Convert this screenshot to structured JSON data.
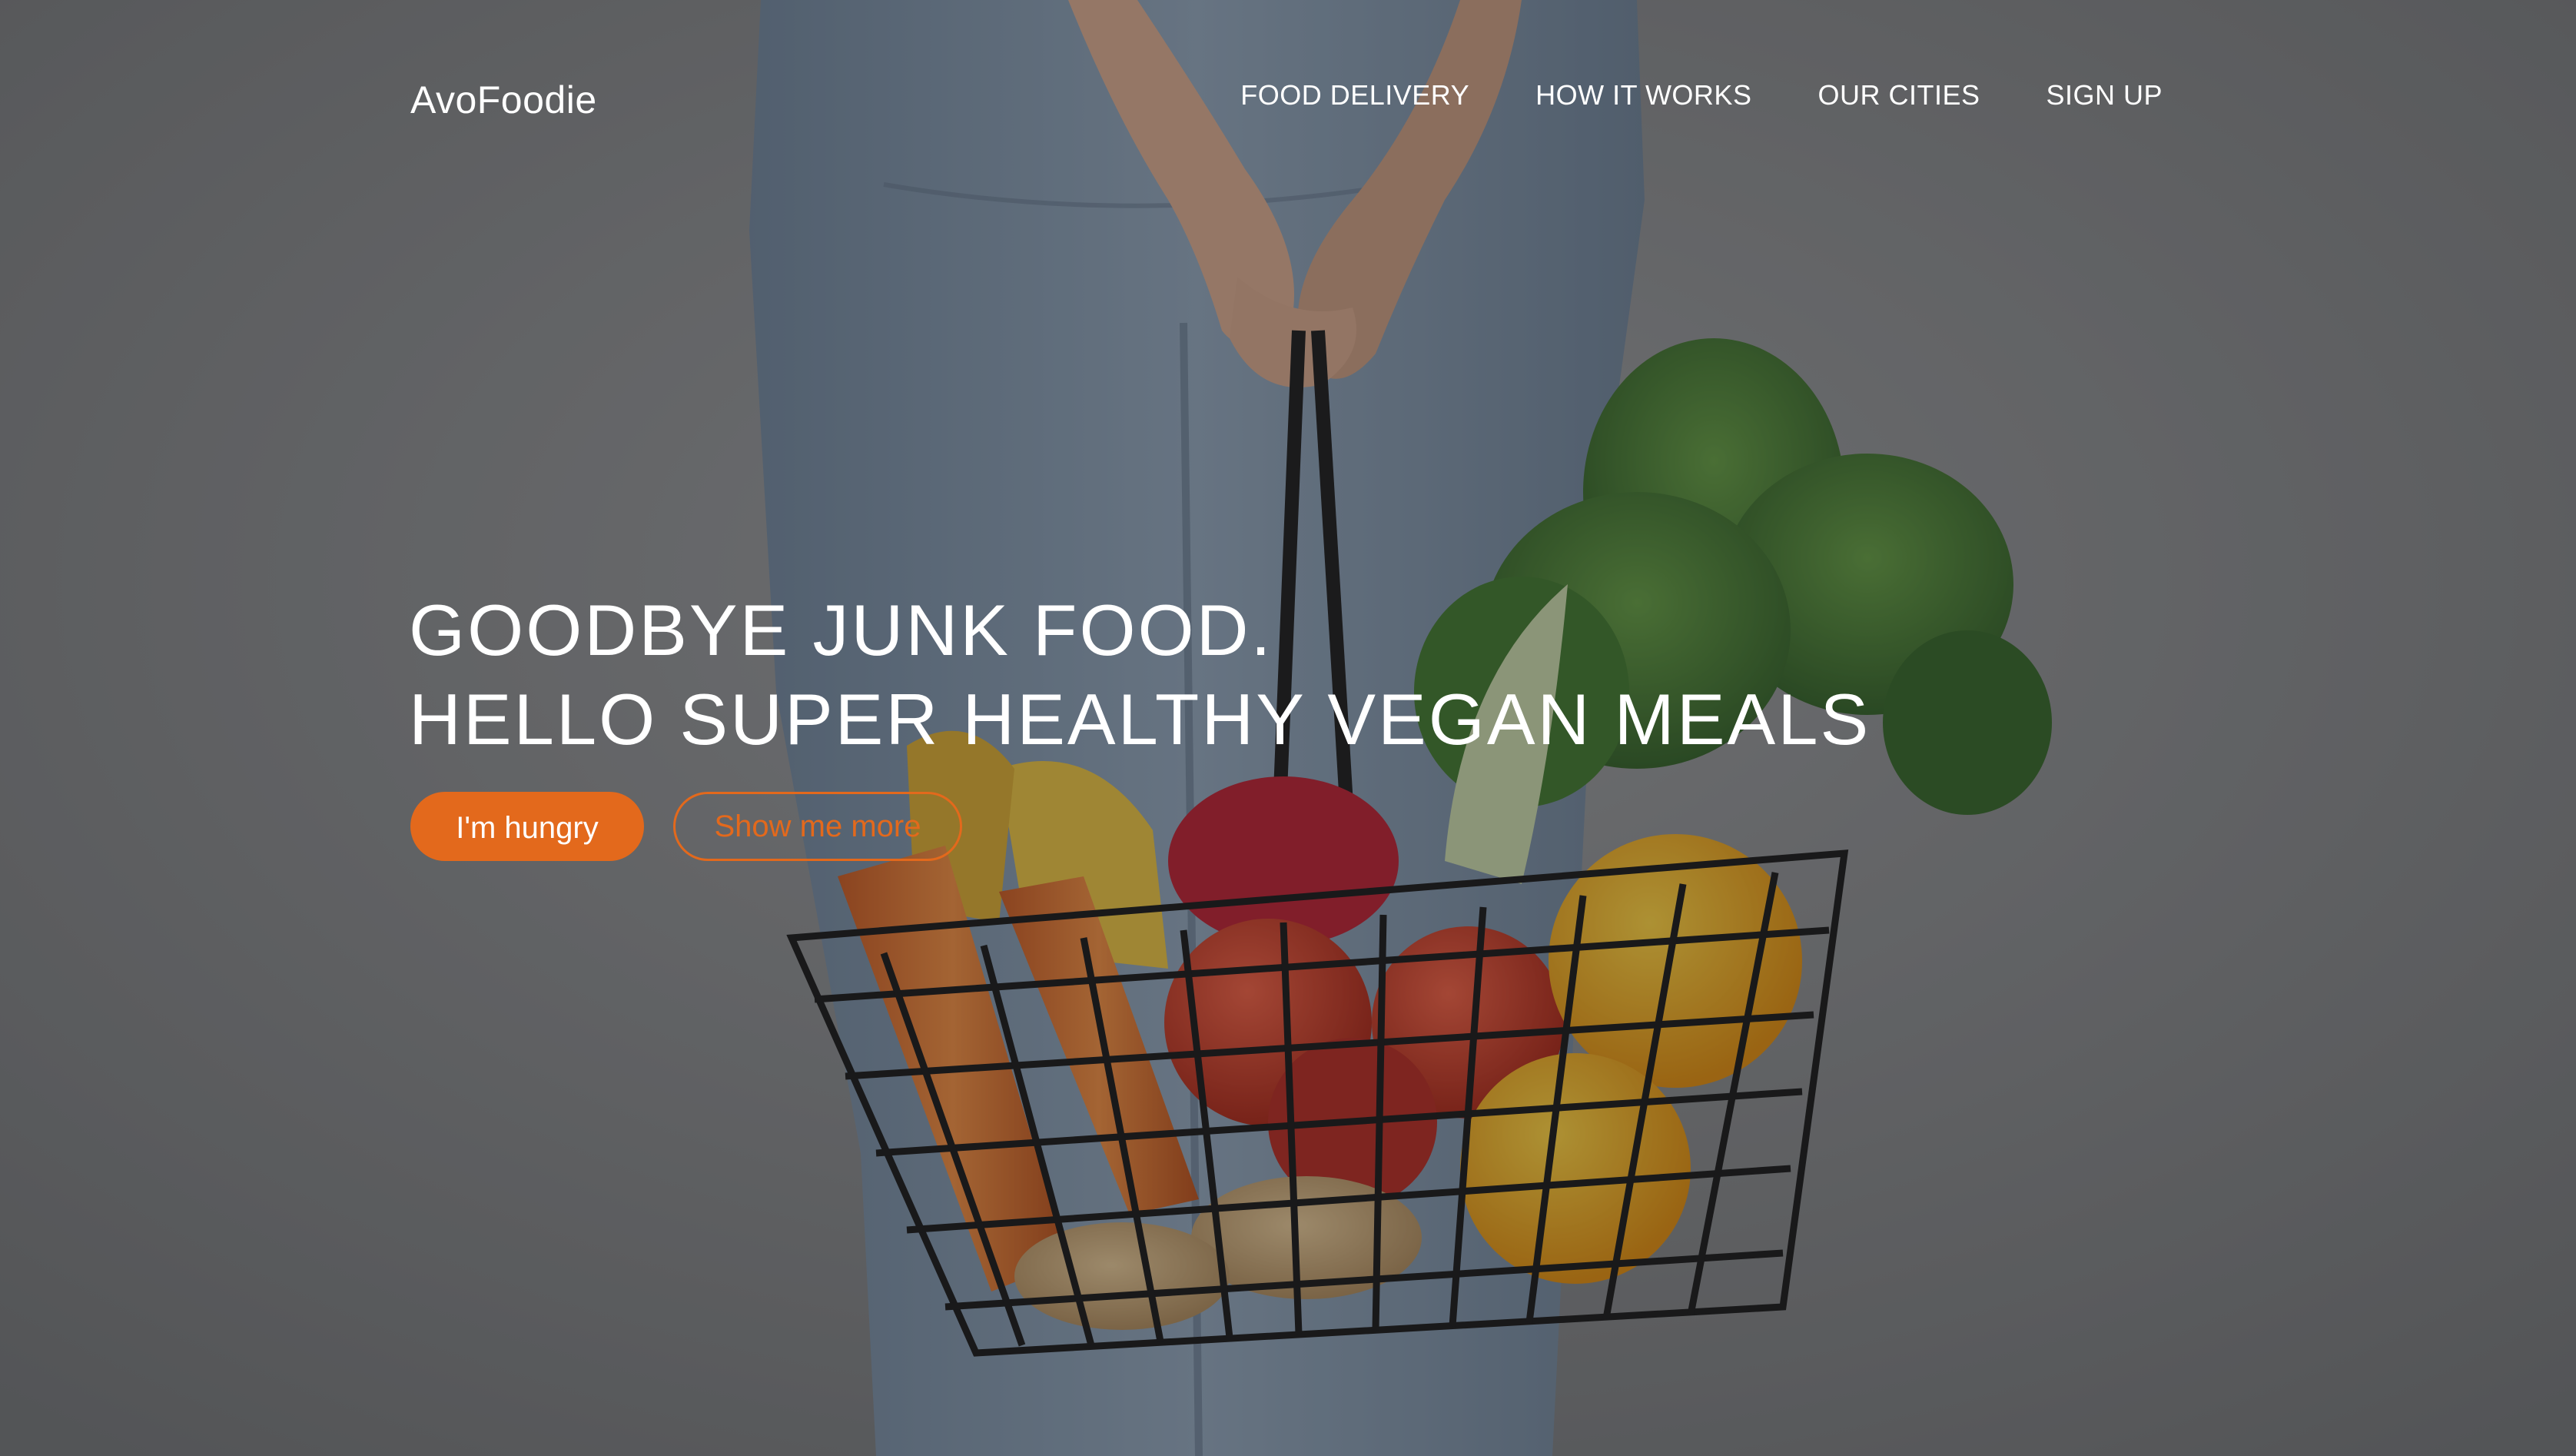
{
  "nav": {
    "logo": "AvoFoodie",
    "items": [
      {
        "label": "FOOD DELIVERY"
      },
      {
        "label": "HOW IT WORKS"
      },
      {
        "label": "OUR CITIES"
      },
      {
        "label": "SIGN UP"
      }
    ]
  },
  "hero": {
    "headline_line1": "GOODBYE JUNK FOOD.",
    "headline_line2": "HELLO SUPER HEALTHY VEGAN MEALS",
    "primary_button": "I'm hungry",
    "secondary_button": "Show me more"
  },
  "colors": {
    "accent": "#e3691c",
    "text": "#ffffff"
  }
}
